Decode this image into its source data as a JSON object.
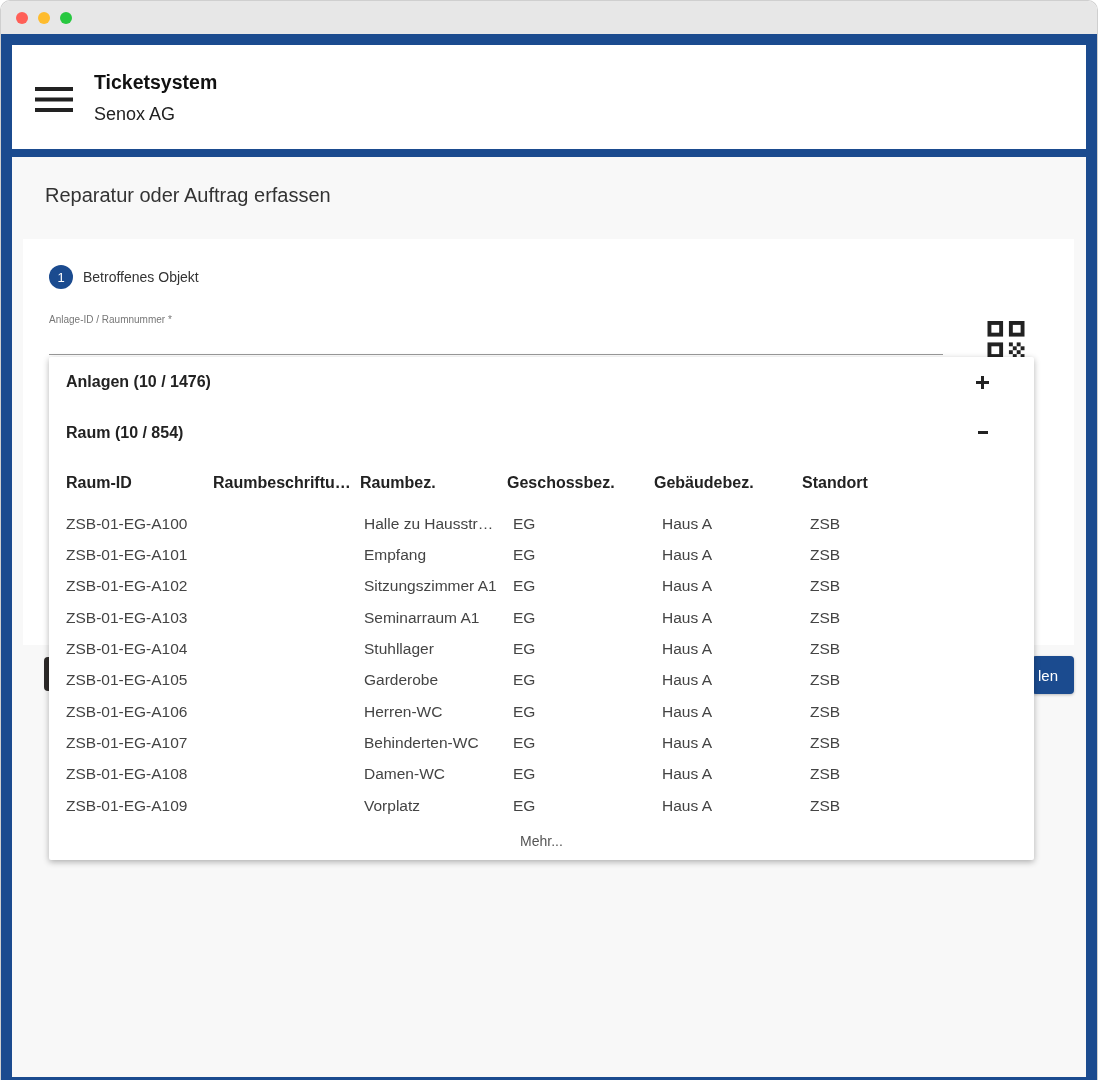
{
  "header": {
    "title": "Ticketsystem",
    "subtitle": "Senox AG"
  },
  "page": {
    "title": "Reparatur oder Auftrag erfassen"
  },
  "form": {
    "step": {
      "number": "1",
      "label": "Betroffenes Objekt"
    },
    "field": {
      "label": "Anlage-ID / Raumnummer *"
    }
  },
  "buttons": [
    {
      "kind": "secondary"
    },
    {
      "kind": "primary",
      "label": "len"
    }
  ],
  "dropdown": {
    "groups": [
      {
        "label": "Anlagen (10 / 1476)",
        "expanded": false
      },
      {
        "label": "Raum (10 / 854)",
        "expanded": true,
        "table": {
          "columns": [
            "Raum-ID",
            "Raumbeschriftu…",
            "Raumbez.",
            "Geschossbez.",
            "Gebäudebez.",
            "Standort"
          ],
          "rows": [
            {
              "raum_id": "ZSB-01-EG-A100",
              "raumbez": "Halle zu Hausstr…",
              "geschossbez": "EG",
              "gebaeudebez": "Haus A",
              "standort": "ZSB"
            },
            {
              "raum_id": "ZSB-01-EG-A101",
              "raumbez": "Empfang",
              "geschossbez": "EG",
              "gebaeudebez": "Haus A",
              "standort": "ZSB"
            },
            {
              "raum_id": "ZSB-01-EG-A102",
              "raumbez": "Sitzungszimmer A1",
              "geschossbez": "EG",
              "gebaeudebez": "Haus A",
              "standort": "ZSB"
            },
            {
              "raum_id": "ZSB-01-EG-A103",
              "raumbez": "Seminarraum A1",
              "geschossbez": "EG",
              "gebaeudebez": "Haus A",
              "standort": "ZSB"
            },
            {
              "raum_id": "ZSB-01-EG-A104",
              "raumbez": "Stuhllager",
              "geschossbez": "EG",
              "gebaeudebez": "Haus A",
              "standort": "ZSB"
            },
            {
              "raum_id": "ZSB-01-EG-A105",
              "raumbez": "Garderobe",
              "geschossbez": "EG",
              "gebaeudebez": "Haus A",
              "standort": "ZSB"
            },
            {
              "raum_id": "ZSB-01-EG-A106",
              "raumbez": "Herren-WC",
              "geschossbez": "EG",
              "gebaeudebez": "Haus A",
              "standort": "ZSB"
            },
            {
              "raum_id": "ZSB-01-EG-A107",
              "raumbez": "Behinderten-WC",
              "geschossbez": "EG",
              "gebaeudebez": "Haus A",
              "standort": "ZSB"
            },
            {
              "raum_id": "ZSB-01-EG-A108",
              "raumbez": "Damen-WC",
              "geschossbez": "EG",
              "gebaeudebez": "Haus A",
              "standort": "ZSB"
            },
            {
              "raum_id": "ZSB-01-EG-A109",
              "raumbez": "Vorplatz",
              "geschossbez": "EG",
              "gebaeudebez": "Haus A",
              "standort": "ZSB"
            }
          ]
        }
      }
    ],
    "more": "Mehr..."
  }
}
